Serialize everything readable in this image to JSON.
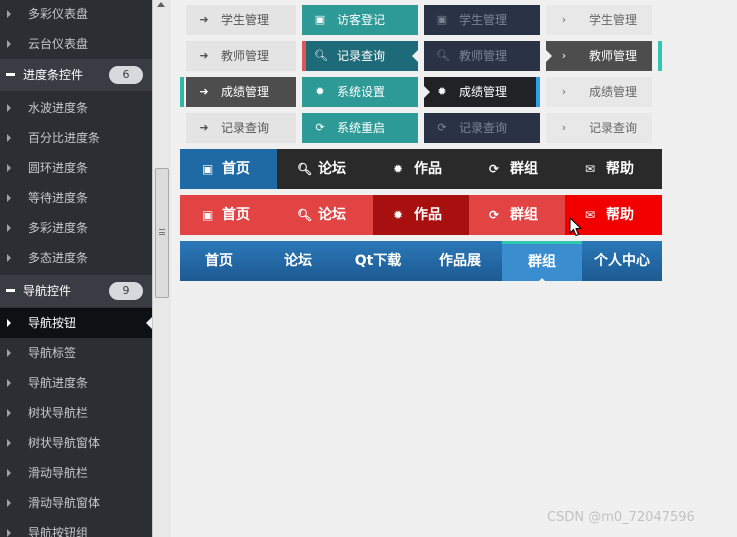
{
  "sidebar": {
    "items_top": [
      {
        "label": "多彩仪表盘"
      },
      {
        "label": "云台仪表盘"
      }
    ],
    "group_progress": {
      "label": "进度条控件",
      "count": "6"
    },
    "items_progress": [
      {
        "label": "水波进度条"
      },
      {
        "label": "百分比进度条"
      },
      {
        "label": "圆环进度条"
      },
      {
        "label": "等待进度条"
      },
      {
        "label": "多彩进度条"
      },
      {
        "label": "多态进度条"
      }
    ],
    "group_nav": {
      "label": "导航控件",
      "count": "9"
    },
    "items_nav": [
      {
        "label": "导航按钮"
      },
      {
        "label": "导航标签"
      },
      {
        "label": "导航进度条"
      },
      {
        "label": "树状导航栏"
      },
      {
        "label": "树状导航窗体"
      },
      {
        "label": "滑动导航栏"
      },
      {
        "label": "滑动导航窗体"
      },
      {
        "label": "导航按钮组"
      }
    ]
  },
  "grid": {
    "rows": [
      [
        "学生管理",
        "访客登记",
        "学生管理",
        "学生管理"
      ],
      [
        "教师管理",
        "记录查询",
        "教师管理",
        "教师管理"
      ],
      [
        "成绩管理",
        "系统设置",
        "成绩管理",
        "成绩管理"
      ],
      [
        "记录查询",
        "系统重启",
        "记录查询",
        "记录查询"
      ]
    ]
  },
  "navbar1": [
    "首页",
    "论坛",
    "作品",
    "群组",
    "帮助"
  ],
  "navbar2": [
    "首页",
    "论坛",
    "作品",
    "群组",
    "帮助"
  ],
  "navbar3": [
    "首页",
    "论坛",
    "Qt下载",
    "作品展",
    "群组",
    "个人中心"
  ],
  "watermark": "CSDN @m0_72047596",
  "colors": {
    "teal": "#2e9a97",
    "navy_blue": "#1f5a8a",
    "red": "#e24444",
    "dark": "#2a2a2a"
  },
  "icons": {
    "col1": "chevron-right",
    "col2": [
      "id-card",
      "search",
      "gear",
      "refresh"
    ],
    "col3": [
      "id-card",
      "search",
      "gear",
      "refresh"
    ],
    "col4": "chevron-right",
    "nav": [
      "id-card",
      "search",
      "gear",
      "refresh",
      "envelope"
    ]
  }
}
